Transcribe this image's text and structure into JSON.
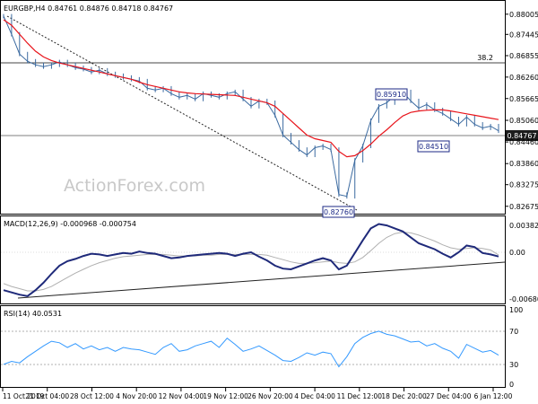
{
  "price_panel": {
    "header": "EURGBP,H4  0.84761 0.84876 0.84718 0.84767",
    "watermark": "ActionForex.com",
    "fib_label": "38.2",
    "callouts": [
      {
        "id": "callout-high",
        "label": "0.85910"
      },
      {
        "id": "callout-low",
        "label": "0.82760"
      },
      {
        "id": "callout-swing",
        "label": "0.84510"
      }
    ],
    "current_price_label": "0.84767"
  },
  "macd_panel": {
    "header": "MACD(12,26,9) -0.000968 -0.000754",
    "scale_labels": [
      "0.00382",
      "0.00",
      "-0.006803"
    ]
  },
  "rsi_panel": {
    "header": "RSI(14) 40.0531",
    "scale_labels": [
      "100",
      "70",
      "30",
      "0"
    ]
  },
  "time_axis": {
    "labels": [
      "11 Oct 2019",
      "21 Oct 04:00",
      "28 Oct 12:00",
      "4 Nov 20:00",
      "12 Nov 04:00",
      "19 Nov 12:00",
      "26 Nov 20:00",
      "4 Dec 04:00",
      "11 Dec 12:00",
      "18 Dec 20:00",
      "27 Dec 04:00",
      "6 Jan 12:00"
    ]
  },
  "colors": {
    "price_bars": "#3b6aa0",
    "sma": "#e8141b",
    "macd_line": "#1f2a7a",
    "macd_signal": "#b0b0b0",
    "rsi": "#3399ff",
    "current_price_bg": "#1c1c1c"
  },
  "chart_data": [
    {
      "type": "line",
      "title": "EURGBP,H4",
      "y_ticks": [
        "0.88005",
        "0.87445",
        "0.86855",
        "0.86260",
        "0.85665",
        "0.85060",
        "0.84460",
        "0.83860",
        "0.83275",
        "0.82675"
      ],
      "ylim": [
        0.8252,
        0.8815
      ],
      "series": [
        {
          "name": "price",
          "values": [
            0.8795,
            0.8745,
            0.869,
            0.867,
            0.866,
            0.8655,
            0.866,
            0.8668,
            0.866,
            0.8652,
            0.8648,
            0.864,
            0.8645,
            0.8635,
            0.863,
            0.8625,
            0.862,
            0.8615,
            0.8595,
            0.859,
            0.8595,
            0.858,
            0.857,
            0.8575,
            0.8565,
            0.858,
            0.8575,
            0.857,
            0.858,
            0.8585,
            0.8565,
            0.8545,
            0.856,
            0.8555,
            0.852,
            0.8465,
            0.8445,
            0.8425,
            0.841,
            0.843,
            0.8435,
            0.8425,
            0.83,
            0.8295,
            0.8395,
            0.8435,
            0.8505,
            0.8545,
            0.8555,
            0.8575,
            0.8585,
            0.856,
            0.854,
            0.855,
            0.8535,
            0.8525,
            0.851,
            0.8495,
            0.8515,
            0.8495,
            0.8485,
            0.849,
            0.8477
          ]
        },
        {
          "name": "",
          "values": [
            0.8785,
            0.877,
            0.8745,
            0.872,
            0.8698,
            0.8682,
            0.8672,
            0.8665,
            0.866,
            0.8655,
            0.865,
            0.8645,
            0.864,
            0.8635,
            0.863,
            0.8625,
            0.862,
            0.8612,
            0.8605,
            0.86,
            0.8595,
            0.859,
            0.8585,
            0.8582,
            0.858,
            0.8579,
            0.8578,
            0.8577,
            0.8576,
            0.8575,
            0.857,
            0.8565,
            0.856,
            0.8555,
            0.8545,
            0.8525,
            0.8505,
            0.8485,
            0.8465,
            0.8455,
            0.845,
            0.8445,
            0.842,
            0.8405,
            0.8408,
            0.8422,
            0.844,
            0.8462,
            0.848,
            0.85,
            0.8518,
            0.8528,
            0.8532,
            0.8534,
            0.8535,
            0.8535,
            0.8532,
            0.8528,
            0.8524,
            0.852,
            0.8516,
            0.8512,
            0.8508
          ]
        }
      ],
      "annotations": [
        "0.85910",
        "0.82760",
        "0.84510",
        "38.2",
        "0.84767"
      ]
    },
    {
      "type": "line",
      "title": "MACD(12,26,9) -0.000968 -0.000754",
      "ylim": [
        -0.006803,
        0.00382
      ],
      "series": [
        {
          "name": "MACD",
          "values": [
            -0.0055,
            -0.0058,
            -0.0061,
            -0.0063,
            -0.0055,
            -0.0045,
            -0.0033,
            -0.0022,
            -0.0016,
            -0.0013,
            -0.0009,
            -0.0006,
            -0.0007,
            -0.0009,
            -0.0007,
            -0.0005,
            -0.0006,
            -0.0003,
            -0.0005,
            -0.0006,
            -0.0009,
            -0.0012,
            -0.0011,
            -0.0009,
            -0.0008,
            -0.0007,
            -0.0006,
            -0.0005,
            -0.0006,
            -0.0009,
            -0.0006,
            -0.0004,
            -0.001,
            -0.0015,
            -0.0022,
            -0.0026,
            -0.0027,
            -0.0023,
            -0.0019,
            -0.0015,
            -0.0012,
            -0.0015,
            -0.0027,
            -0.0022,
            -0.0005,
            0.0012,
            0.0028,
            0.0034,
            0.0032,
            0.0028,
            0.0024,
            0.0016,
            0.0008,
            0.0004,
            0.0,
            -0.0006,
            -0.0011,
            -0.0004,
            0.0005,
            0.0003,
            -0.0005,
            -0.0007,
            -0.00097
          ]
        },
        {
          "name": "Signal",
          "values": [
            -0.0046,
            -0.005,
            -0.0053,
            -0.0056,
            -0.0056,
            -0.0054,
            -0.005,
            -0.0044,
            -0.0038,
            -0.0032,
            -0.0027,
            -0.0022,
            -0.0018,
            -0.0015,
            -0.0012,
            -0.001,
            -0.0009,
            -0.0008,
            -0.0007,
            -0.0007,
            -0.0007,
            -0.0008,
            -0.0009,
            -0.0009,
            -0.0009,
            -0.0008,
            -0.0008,
            -0.0007,
            -0.0007,
            -0.0007,
            -0.0007,
            -0.0007,
            -0.0007,
            -0.0008,
            -0.0011,
            -0.0014,
            -0.0017,
            -0.0019,
            -0.0019,
            -0.0018,
            -0.0017,
            -0.0016,
            -0.0018,
            -0.0019,
            -0.0017,
            -0.0011,
            -0.0002,
            0.0008,
            0.0016,
            0.0021,
            0.0023,
            0.0022,
            0.0019,
            0.0015,
            0.0011,
            0.0006,
            0.0002,
            0.0,
            0.0001,
            0.0002,
            0.0001,
            -0.0001,
            -0.00075
          ]
        }
      ]
    },
    {
      "type": "line",
      "title": "RSI(14) 40.0531",
      "ylim": [
        0,
        100
      ],
      "series": [
        {
          "name": "RSI",
          "values": [
            28,
            32,
            30,
            38,
            45,
            52,
            58,
            56,
            50,
            55,
            48,
            52,
            47,
            50,
            45,
            50,
            48,
            47,
            44,
            41,
            50,
            55,
            45,
            47,
            52,
            55,
            58,
            50,
            62,
            54,
            45,
            48,
            52,
            46,
            40,
            33,
            32,
            37,
            43,
            40,
            44,
            42,
            25,
            38,
            55,
            63,
            68,
            71,
            67,
            65,
            61,
            57,
            58,
            52,
            55,
            49,
            45,
            36,
            54,
            49,
            44,
            46,
            40
          ]
        }
      ]
    }
  ]
}
